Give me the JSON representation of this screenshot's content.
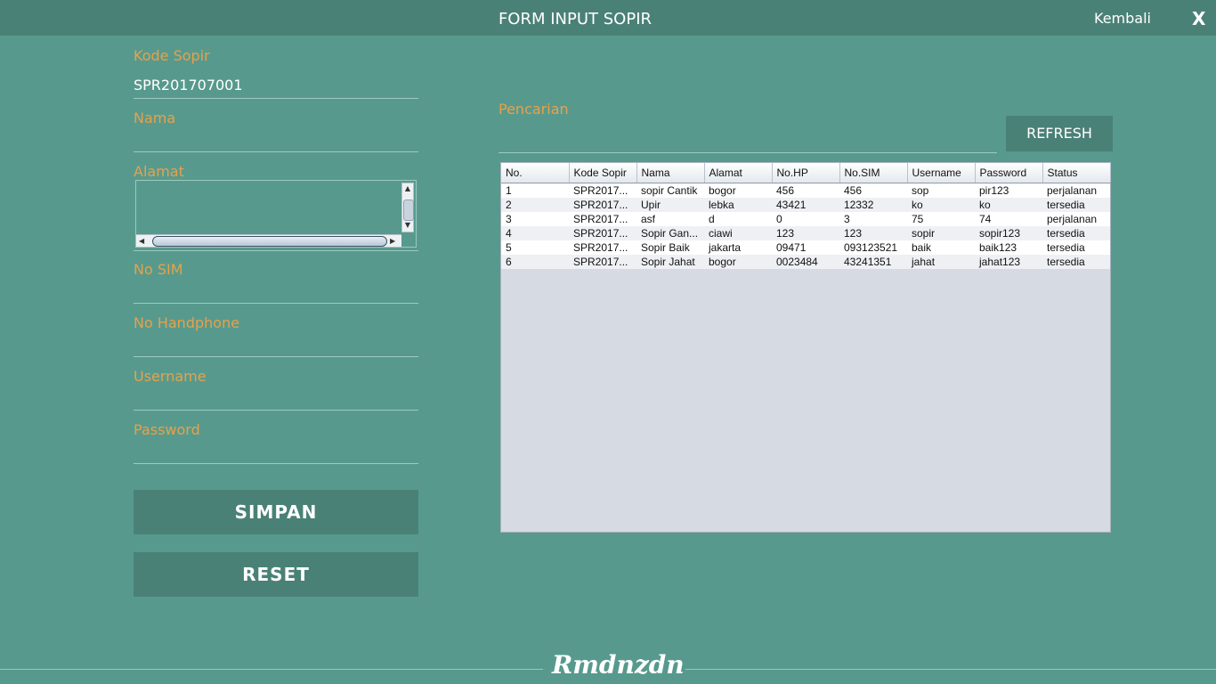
{
  "header": {
    "title": "FORM INPUT SOPIR",
    "back_label": "Kembali",
    "close_label": "X"
  },
  "form": {
    "kode_sopir": {
      "label": "Kode Sopir",
      "value": "SPR201707001"
    },
    "nama": {
      "label": "Nama",
      "value": ""
    },
    "alamat": {
      "label": "Alamat",
      "value": ""
    },
    "no_sim": {
      "label": "No SIM",
      "value": ""
    },
    "no_handphone": {
      "label": "No Handphone",
      "value": ""
    },
    "username": {
      "label": "Username",
      "value": ""
    },
    "password": {
      "label": "Password",
      "value": ""
    },
    "save_label": "SIMPAN",
    "reset_label": "RESET"
  },
  "search": {
    "label": "Pencarian",
    "value": "",
    "refresh_label": "REFRESH"
  },
  "table": {
    "columns": [
      "No.",
      "Kode Sopir",
      "Nama",
      "Alamat",
      "No.HP",
      "No.SIM",
      "Username",
      "Password",
      "Status"
    ],
    "rows": [
      [
        "1",
        "SPR2017...",
        "sopir Cantik",
        "bogor",
        "456",
        "456",
        "sop",
        "pir123",
        "perjalanan"
      ],
      [
        "2",
        "SPR2017...",
        "Upir",
        "lebka",
        "43421",
        "12332",
        "ko",
        "ko",
        "tersedia"
      ],
      [
        "3",
        "SPR2017...",
        "asf",
        "d",
        "0",
        "3",
        "75",
        "74",
        "perjalanan"
      ],
      [
        "4",
        "SPR2017...",
        "Sopir Gan...",
        "ciawi",
        "123",
        "123",
        "sopir",
        "sopir123",
        "tersedia"
      ],
      [
        "5",
        "SPR2017...",
        "Sopir Baik",
        "jakarta",
        "09471",
        "093123521",
        "baik",
        "baik123",
        "tersedia"
      ],
      [
        "6",
        "SPR2017...",
        "Sopir Jahat",
        "bogor",
        "0023484",
        "43241351",
        "jahat",
        "jahat123",
        "tersedia"
      ]
    ]
  },
  "footer": {
    "logo_text": "Rmdnzdn"
  },
  "colors": {
    "background": "#579A8D",
    "header_bar": "#4A8177",
    "label_orange": "#E9A04A",
    "button": "#4A8177"
  }
}
